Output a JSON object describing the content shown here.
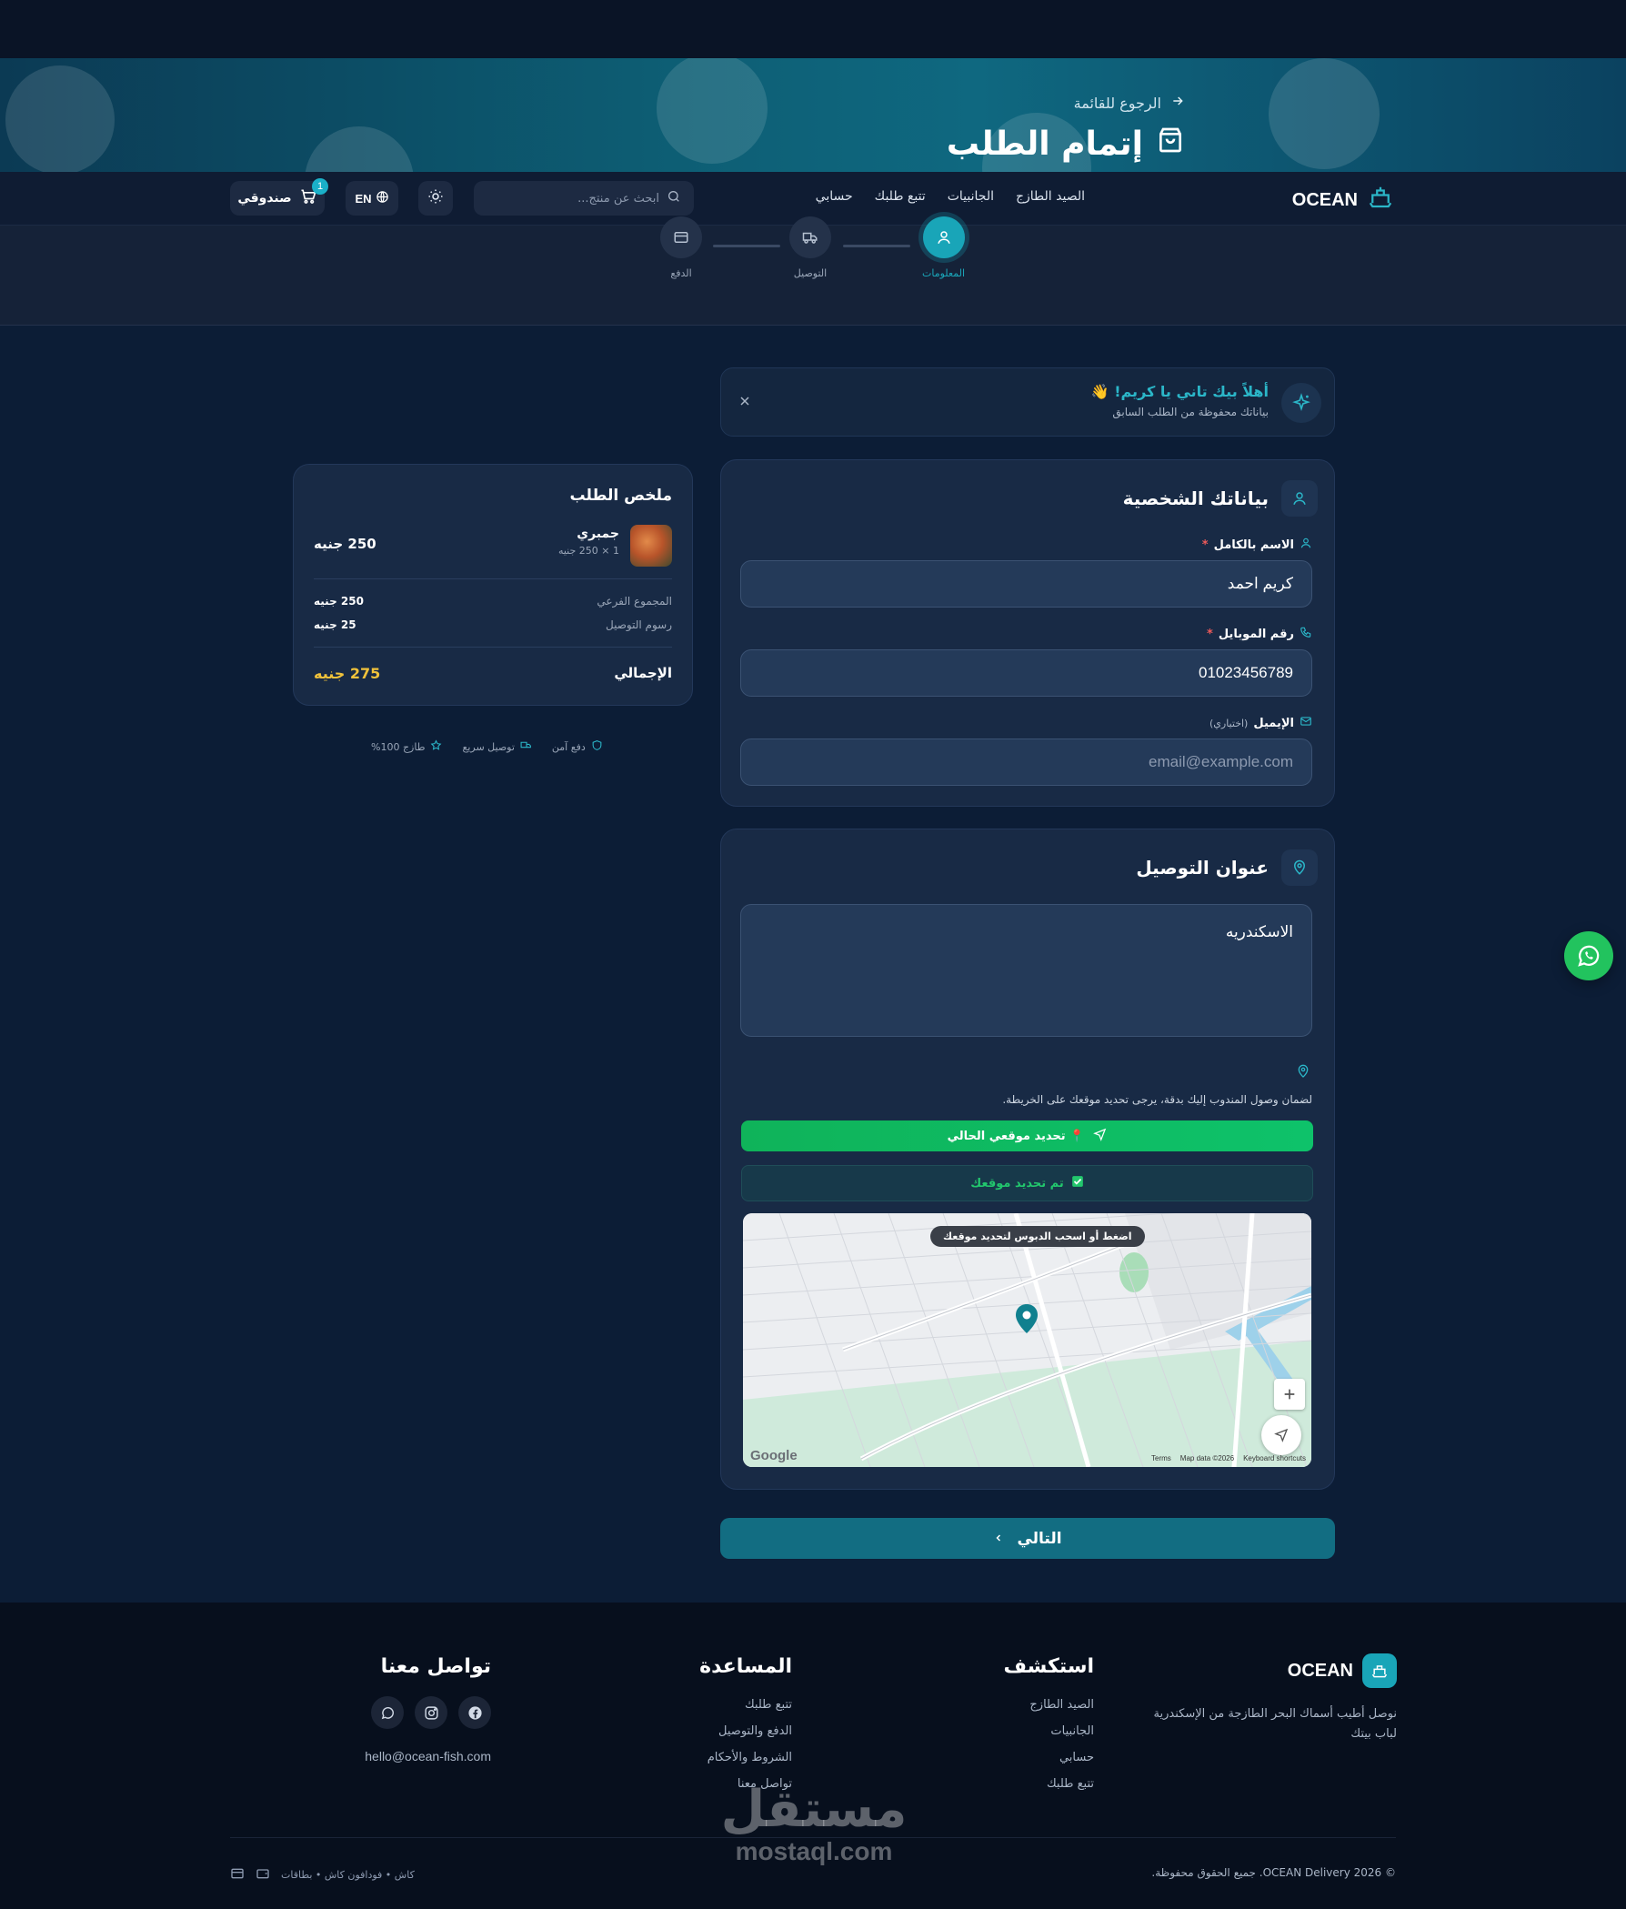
{
  "hero": {
    "back_label": "الرجوع للقائمة",
    "title": "إتمام الطلب"
  },
  "nav": {
    "brand": "OCEAN",
    "links": [
      "الصيد الطازج",
      "الجانبيات",
      "تتبع طلبك",
      "حسابي"
    ],
    "search_placeholder": "ابحث عن منتج...",
    "lang": "EN",
    "cart_label": "صندوقي",
    "cart_count": "1"
  },
  "steps": [
    {
      "label": "المعلومات",
      "icon": "user-icon",
      "active": true
    },
    {
      "label": "التوصيل",
      "icon": "truck-icon",
      "active": false
    },
    {
      "label": "الدفع",
      "icon": "card-icon",
      "active": false
    }
  ],
  "welcome": {
    "title": "أهلاً بيك تاني يا كريم! 👋",
    "subtitle": "بياناتك محفوظة من الطلب السابق"
  },
  "personal": {
    "title": "بياناتك الشخصية",
    "name_label": "الاسم بالكامل",
    "name_value": "كريم احمد",
    "phone_label": "رقم الموبايل",
    "phone_value": "01023456789",
    "email_label": "الإيميل",
    "email_optional": "(اختياري)",
    "email_placeholder": "email@example.com",
    "required_mark": "*"
  },
  "address": {
    "title": "عنوان التوصيل",
    "value": "الاسكندريه",
    "hint": "لضمان وصول المندوب إليك بدقة، يرجى تحديد موقعك على الخريطة.",
    "locate_button": "📍 تحديد موقعي الحالي",
    "confirmed": "تم تحديد موقعك",
    "map_tooltip": "اضغط أو اسحب الدبوس لتحديد موقعك",
    "map_footer": [
      "Keyboard shortcuts",
      "Map data ©2026",
      "Terms"
    ],
    "google": "Google"
  },
  "next_button": "التالي",
  "summary": {
    "title": "ملخص الطلب",
    "item_name": "جمبري",
    "item_qty": "1 × 250 جنيه",
    "item_price": "250 جنيه",
    "subtotal_label": "المجموع الفرعي",
    "subtotal_value": "250 جنيه",
    "delivery_label": "رسوم التوصيل",
    "delivery_value": "25 جنيه",
    "total_label": "الإجمالي",
    "total_value": "275 جنيه"
  },
  "badges": [
    "دفع آمن",
    "توصيل سريع",
    "طازج 100%"
  ],
  "footer": {
    "brand": "OCEAN",
    "tagline_1": "نوصل أطيب أسماك البحر الطازجة من الإسكندرية",
    "tagline_2": "لباب بيتك",
    "explore_title": "استكشف",
    "explore_links": [
      "الصيد الطازج",
      "الجانبيات",
      "حسابي",
      "تتبع طلبك"
    ],
    "help_title": "المساعدة",
    "help_links": [
      "تتبع طلبك",
      "الدفع والتوصيل",
      "الشروط والأحكام",
      "تواصل معنا"
    ],
    "contact_title": "تواصل معنا",
    "email": "hello@ocean-fish.com",
    "copyright": "© 2026 OCEAN Delivery. جميع الحقوق محفوظة.",
    "payments": "كاش • فودافون كاش • بطاقات",
    "watermark_ar": "مستقل",
    "watermark_en": "mostaql.com"
  },
  "colors": {
    "accent": "#19a5b8",
    "total": "#f0c23b",
    "green": "#0fb35a",
    "required": "#ef5a5a"
  }
}
